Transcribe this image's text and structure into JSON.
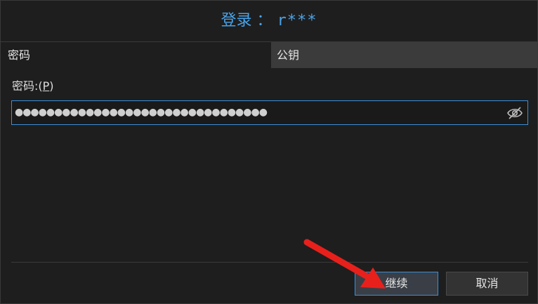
{
  "dialog": {
    "title_prefix": "登录 ： ",
    "title_user": "r***"
  },
  "tabs": [
    {
      "label": "密码",
      "active": true
    },
    {
      "label": "公钥",
      "active": false
    }
  ],
  "password_field": {
    "label": "密码:(",
    "mnemonic": "P",
    "label_suffix": ")",
    "masked_value": "●●●●●●●●●●●●●●●●●●●●●●●●●●●●●●●●"
  },
  "buttons": {
    "continue_label": "继续",
    "cancel_label": "取消"
  },
  "colors": {
    "accent": "#4aa3e8",
    "focus_border": "#3b8fd6",
    "annotation_arrow": "#e8201c"
  }
}
